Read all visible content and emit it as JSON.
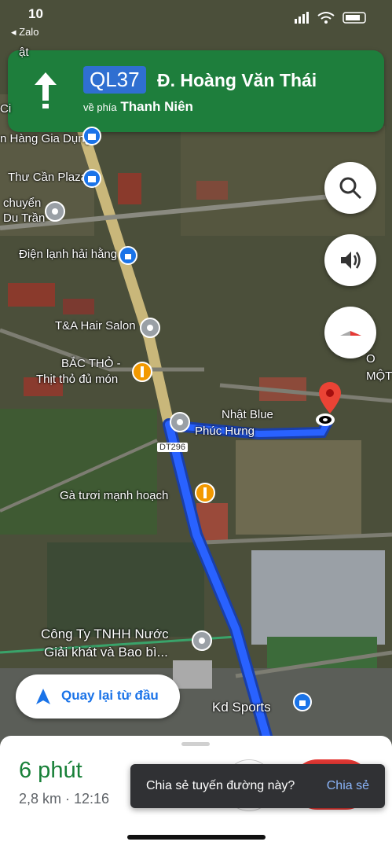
{
  "status_bar": {
    "time": "10",
    "back_app": "◂ Zalo"
  },
  "nav": {
    "route_number": "QL37",
    "street": "Đ. Hoàng Văn Thái",
    "toward_prefix": "về phía",
    "toward_place": "Thanh Niên"
  },
  "controls": {
    "search_icon": "search-icon",
    "sound_icon": "volume-icon",
    "compass_icon": "compass-icon"
  },
  "map_labels": {
    "hang_gia_dung": "n Hàng Gia Dụng",
    "thu_can_plaza": "Thư Cần Plaza",
    "chuyen": "chuyển",
    "du_tran": "Du Trần",
    "dien_lanh": "Điện lạnh hải hằng",
    "ta_hair": "T&A Hair Salon",
    "bac_tho": "BẮC THỎ -",
    "thit_tho": "Thịt thỏ đủ món",
    "nhat_blue": "Nhật Blue",
    "phuc_hung": "Phúc Hưng",
    "dt296": "DT296",
    "ga_tuoi": "Gà tươi mạnh hoạch",
    "cong_ty_1": "Công Ty TNHH Nước",
    "cong_ty_2": "Giải khát và Bao bì...",
    "kd_sports": "Kd Sports",
    "mot": "MỘT",
    "o": "O",
    "top_left_1": "ật",
    "top_left_2": "Ci"
  },
  "reroute_button": {
    "label": "Quay lại từ đầu"
  },
  "trip": {
    "duration": "6 phút",
    "distance_eta": "2,8 km · 12:16"
  },
  "snackbar": {
    "message": "Chia sẻ tuyến đường này?",
    "action": "Chia sẻ"
  },
  "colors": {
    "banner_green": "#1e7e3c",
    "route_blue": "#2962ff",
    "eta_green": "#188038",
    "shield_blue": "#2f6fd1"
  }
}
